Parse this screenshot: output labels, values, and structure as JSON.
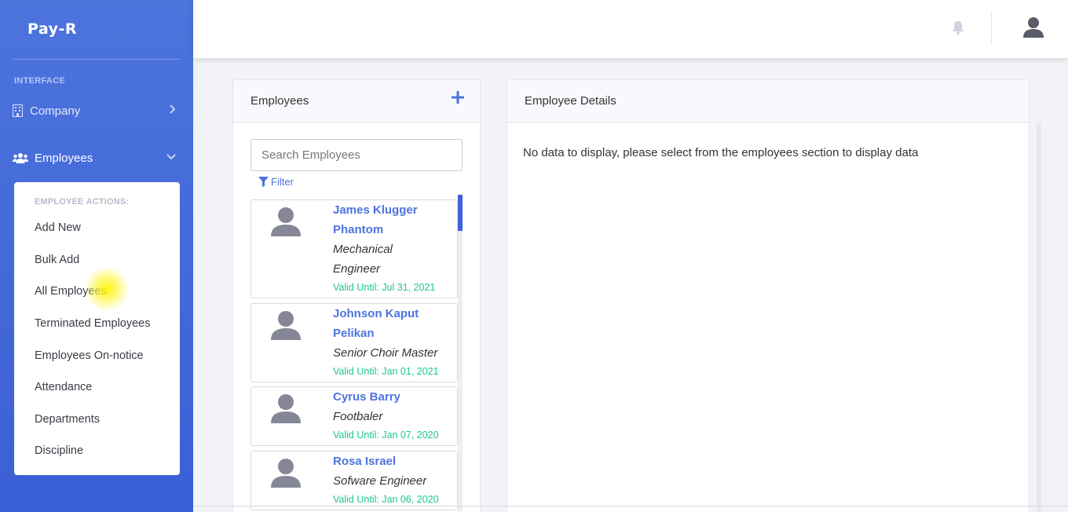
{
  "brand": "Pay-R",
  "sidebar": {
    "heading": "INTERFACE",
    "items": [
      {
        "label": "Company",
        "icon": "building-icon"
      },
      {
        "label": "Employees",
        "icon": "users-icon"
      }
    ],
    "submenu": {
      "heading": "EMPLOYEE ACTIONS:",
      "items": [
        "Add New",
        "Bulk Add",
        "All Employees",
        "Terminated Employees",
        "Employees On-notice",
        "Attendance",
        "Departments",
        "Discipline"
      ]
    }
  },
  "employees_panel": {
    "title": "Employees",
    "search_placeholder": "Search Employees",
    "filter_label": "Filter",
    "list": [
      {
        "name_lines": [
          "James Klugger",
          "Phantom"
        ],
        "title_lines": [
          "Mechanical",
          "Engineer"
        ],
        "valid": "Valid Until: Jul 31, 2021"
      },
      {
        "name_lines": [
          "Johnson Kaput",
          "Pelikan"
        ],
        "title_lines": [
          "Senior Choir Master"
        ],
        "valid": "Valid Until: Jan 01, 2021"
      },
      {
        "name_lines": [
          "Cyrus Barry"
        ],
        "title_lines": [
          "Footbaler"
        ],
        "valid": "Valid Until: Jan 07, 2020"
      },
      {
        "name_lines": [
          "Rosa Israel"
        ],
        "title_lines": [
          "Sofware Engineer"
        ],
        "valid": "Valid Until: Jan 06, 2020"
      }
    ]
  },
  "details_panel": {
    "title": "Employee Details",
    "empty_message": "No data to display, please select from the employees section to display data"
  },
  "colors": {
    "primary": "#4e73df",
    "success": "#1cc88a",
    "sidebar": "#4468db"
  }
}
